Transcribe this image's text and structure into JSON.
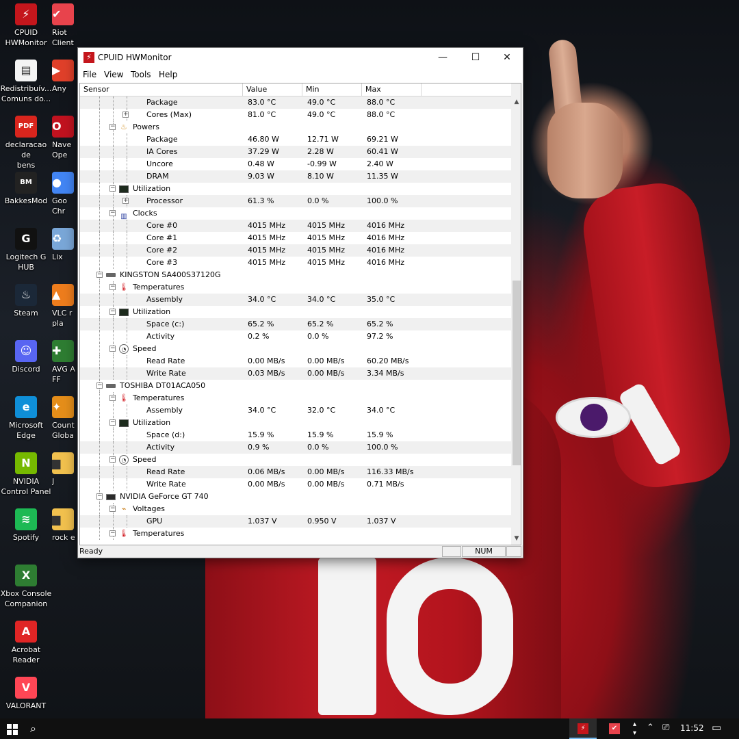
{
  "desktop": {
    "icons": [
      {
        "label": "CPUID\nHWMonitor",
        "icon": "hwmonitor-icon"
      },
      {
        "label": "Riot Client",
        "icon": "riot-client-icon"
      },
      {
        "label": "Redistribuív...\nComuns do...",
        "icon": "file-shortcut-icon"
      },
      {
        "label": "Any",
        "icon": "anydesk-icon"
      },
      {
        "label": "declaracao de\nbens",
        "icon": "pdf-icon"
      },
      {
        "label": "Nave\nOpe",
        "icon": "opera-icon"
      },
      {
        "label": "BakkesMod",
        "icon": "bakkesmod-icon"
      },
      {
        "label": "Goo\nChr",
        "icon": "chrome-icon"
      },
      {
        "label": "Logitech G\nHUB",
        "icon": "logitech-ghub-icon"
      },
      {
        "label": "Lix",
        "icon": "recycle-bin-icon"
      },
      {
        "label": "Steam",
        "icon": "steam-icon"
      },
      {
        "label": "VLC r\npla",
        "icon": "vlc-icon"
      },
      {
        "label": "Discord",
        "icon": "discord-icon"
      },
      {
        "label": "AVG A\nFF",
        "icon": "avg-icon"
      },
      {
        "label": "Microsoft\nEdge",
        "icon": "edge-icon"
      },
      {
        "label": "Count\nGloba",
        "icon": "csgo-icon"
      },
      {
        "label": "NVIDIA\nControl Panel",
        "icon": "nvidia-icon"
      },
      {
        "label": "J",
        "icon": "folder-icon"
      },
      {
        "label": "Spotify",
        "icon": "spotify-icon"
      },
      {
        "label": "rock e",
        "icon": "folder-icon"
      },
      {
        "label": "Xbox Console\nCompanion",
        "icon": "xbox-icon"
      },
      {
        "label": "Acrobat\nReader",
        "icon": "acrobat-icon"
      },
      {
        "label": "VALORANT",
        "icon": "valorant-icon"
      }
    ]
  },
  "window": {
    "title": "CPUID HWMonitor",
    "menu": [
      "File",
      "View",
      "Tools",
      "Help"
    ],
    "columns": [
      "Sensor",
      "Value",
      "Min",
      "Max"
    ],
    "status": {
      "text": "Ready",
      "num": "NUM"
    },
    "rows": [
      {
        "level": 3,
        "label": "Package",
        "value": "83.0 °C",
        "min": "49.0 °C",
        "max": "88.0 °C"
      },
      {
        "level": 3,
        "label": "Cores (Max)",
        "value": "81.0 °C",
        "min": "49.0 °C",
        "max": "88.0 °C",
        "expander": "+"
      },
      {
        "level": 2,
        "label": "Powers",
        "icon": "power",
        "expander": "-"
      },
      {
        "level": 3,
        "label": "Package",
        "value": "46.80 W",
        "min": "12.71 W",
        "max": "69.21 W"
      },
      {
        "level": 3,
        "label": "IA Cores",
        "value": "37.29 W",
        "min": "2.28 W",
        "max": "60.41 W"
      },
      {
        "level": 3,
        "label": "Uncore",
        "value": "0.48 W",
        "min": "-0.99 W",
        "max": "2.40 W"
      },
      {
        "level": 3,
        "label": "DRAM",
        "value": "9.03 W",
        "min": "8.10 W",
        "max": "11.35 W"
      },
      {
        "level": 2,
        "label": "Utilization",
        "icon": "util",
        "expander": "-"
      },
      {
        "level": 3,
        "label": "Processor",
        "value": "61.3 %",
        "min": "0.0 %",
        "max": "100.0 %",
        "expander": "+"
      },
      {
        "level": 2,
        "label": "Clocks",
        "icon": "clock",
        "expander": "-"
      },
      {
        "level": 3,
        "label": "Core #0",
        "value": "4015 MHz",
        "min": "4015 MHz",
        "max": "4016 MHz"
      },
      {
        "level": 3,
        "label": "Core #1",
        "value": "4015 MHz",
        "min": "4015 MHz",
        "max": "4016 MHz"
      },
      {
        "level": 3,
        "label": "Core #2",
        "value": "4015 MHz",
        "min": "4015 MHz",
        "max": "4016 MHz"
      },
      {
        "level": 3,
        "label": "Core #3",
        "value": "4015 MHz",
        "min": "4015 MHz",
        "max": "4016 MHz"
      },
      {
        "level": 1,
        "label": "KINGSTON SA400S37120G",
        "icon": "disk",
        "expander": "-"
      },
      {
        "level": 2,
        "label": "Temperatures",
        "icon": "therm",
        "expander": "-"
      },
      {
        "level": 3,
        "label": "Assembly",
        "value": "34.0 °C",
        "min": "34.0 °C",
        "max": "35.0 °C"
      },
      {
        "level": 2,
        "label": "Utilization",
        "icon": "util",
        "expander": "-"
      },
      {
        "level": 3,
        "label": "Space (c:)",
        "value": "65.2 %",
        "min": "65.2 %",
        "max": "65.2 %"
      },
      {
        "level": 3,
        "label": "Activity",
        "value": "0.2 %",
        "min": "0.0 %",
        "max": "97.2 %"
      },
      {
        "level": 2,
        "label": "Speed",
        "icon": "speed",
        "expander": "-"
      },
      {
        "level": 3,
        "label": "Read Rate",
        "value": "0.00 MB/s",
        "min": "0.00 MB/s",
        "max": "60.20 MB/s"
      },
      {
        "level": 3,
        "label": "Write Rate",
        "value": "0.03 MB/s",
        "min": "0.00 MB/s",
        "max": "3.34 MB/s"
      },
      {
        "level": 1,
        "label": "TOSHIBA DT01ACA050",
        "icon": "disk",
        "expander": "-"
      },
      {
        "level": 2,
        "label": "Temperatures",
        "icon": "therm",
        "expander": "-"
      },
      {
        "level": 3,
        "label": "Assembly",
        "value": "34.0 °C",
        "min": "32.0 °C",
        "max": "34.0 °C"
      },
      {
        "level": 2,
        "label": "Utilization",
        "icon": "util",
        "expander": "-"
      },
      {
        "level": 3,
        "label": "Space (d:)",
        "value": "15.9 %",
        "min": "15.9 %",
        "max": "15.9 %"
      },
      {
        "level": 3,
        "label": "Activity",
        "value": "0.9 %",
        "min": "0.0 %",
        "max": "100.0 %"
      },
      {
        "level": 2,
        "label": "Speed",
        "icon": "speed",
        "expander": "-"
      },
      {
        "level": 3,
        "label": "Read Rate",
        "value": "0.06 MB/s",
        "min": "0.00 MB/s",
        "max": "116.33 MB/s"
      },
      {
        "level": 3,
        "label": "Write Rate",
        "value": "0.00 MB/s",
        "min": "0.00 MB/s",
        "max": "0.71 MB/s"
      },
      {
        "level": 1,
        "label": "NVIDIA GeForce GT 740",
        "icon": "gpu",
        "expander": "-"
      },
      {
        "level": 2,
        "label": "Voltages",
        "icon": "volt",
        "expander": "-"
      },
      {
        "level": 3,
        "label": "GPU",
        "value": "1.037 V",
        "min": "0.950 V",
        "max": "1.037 V"
      },
      {
        "level": 2,
        "label": "Temperatures",
        "icon": "therm",
        "expander": "-"
      }
    ]
  },
  "taskbar": {
    "clock": "11:52",
    "apps": [
      "hwmonitor-icon",
      "riot-client-icon"
    ]
  }
}
